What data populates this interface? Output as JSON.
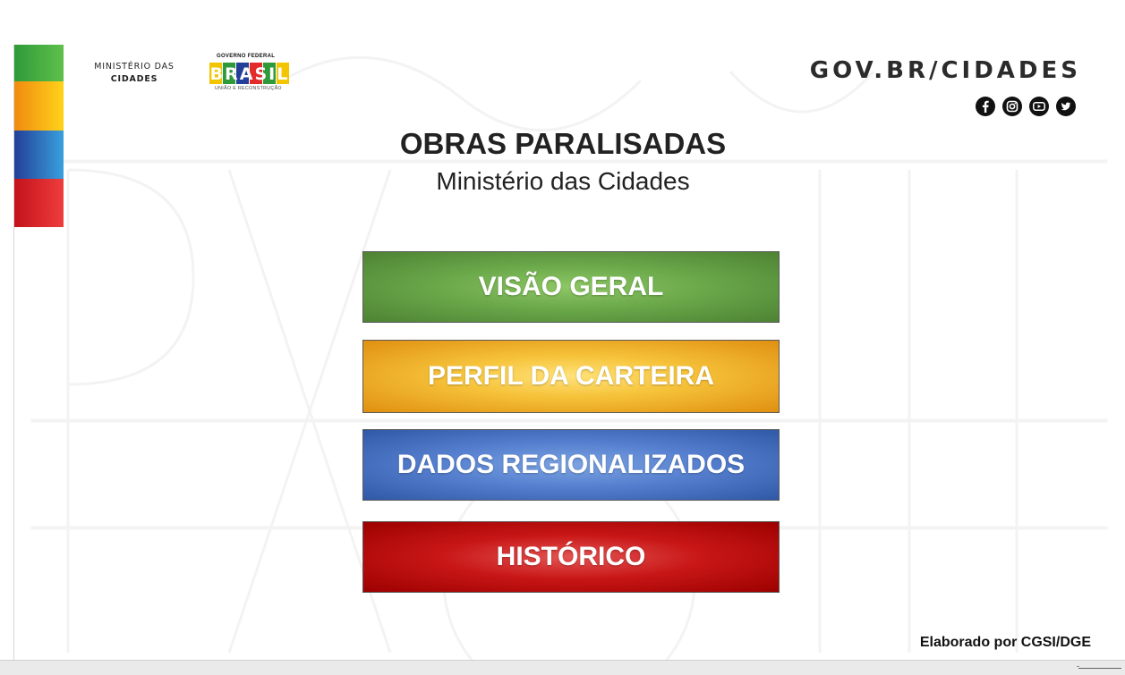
{
  "header": {
    "ministry_line1": "MINISTÉRIO DAS",
    "ministry_line2": "CIDADES",
    "brasil_top": "GOVERNO FEDERAL",
    "brasil_word": "BRASIL",
    "brasil_bottom": "UNIÃO E RECONSTRUÇÃO",
    "govbr": "GOV.BR/CIDADES",
    "social_icons": [
      "facebook-icon",
      "instagram-icon",
      "youtube-icon",
      "twitter-icon"
    ]
  },
  "page": {
    "title": "OBRAS PARALISADAS",
    "subtitle": "Ministério das Cidades"
  },
  "nav": {
    "visao_geral": "VISÃO GERAL",
    "perfil_carteira": "PERFIL DA CARTEIRA",
    "dados_regionalizados": "DADOS REGIONALIZADOS",
    "historico": "HISTÓRICO"
  },
  "footer": {
    "credit": "Elaborado por CGSI/DGE"
  },
  "colors": {
    "green": "#5f9a3f",
    "yellow": "#f3b52b",
    "blue": "#4b74c2",
    "red": "#c11212",
    "flag_green": "#2f9a3a",
    "flag_yellow": "#ffd21a",
    "flag_blue": "#233f97",
    "flag_red": "#e32b2b"
  }
}
